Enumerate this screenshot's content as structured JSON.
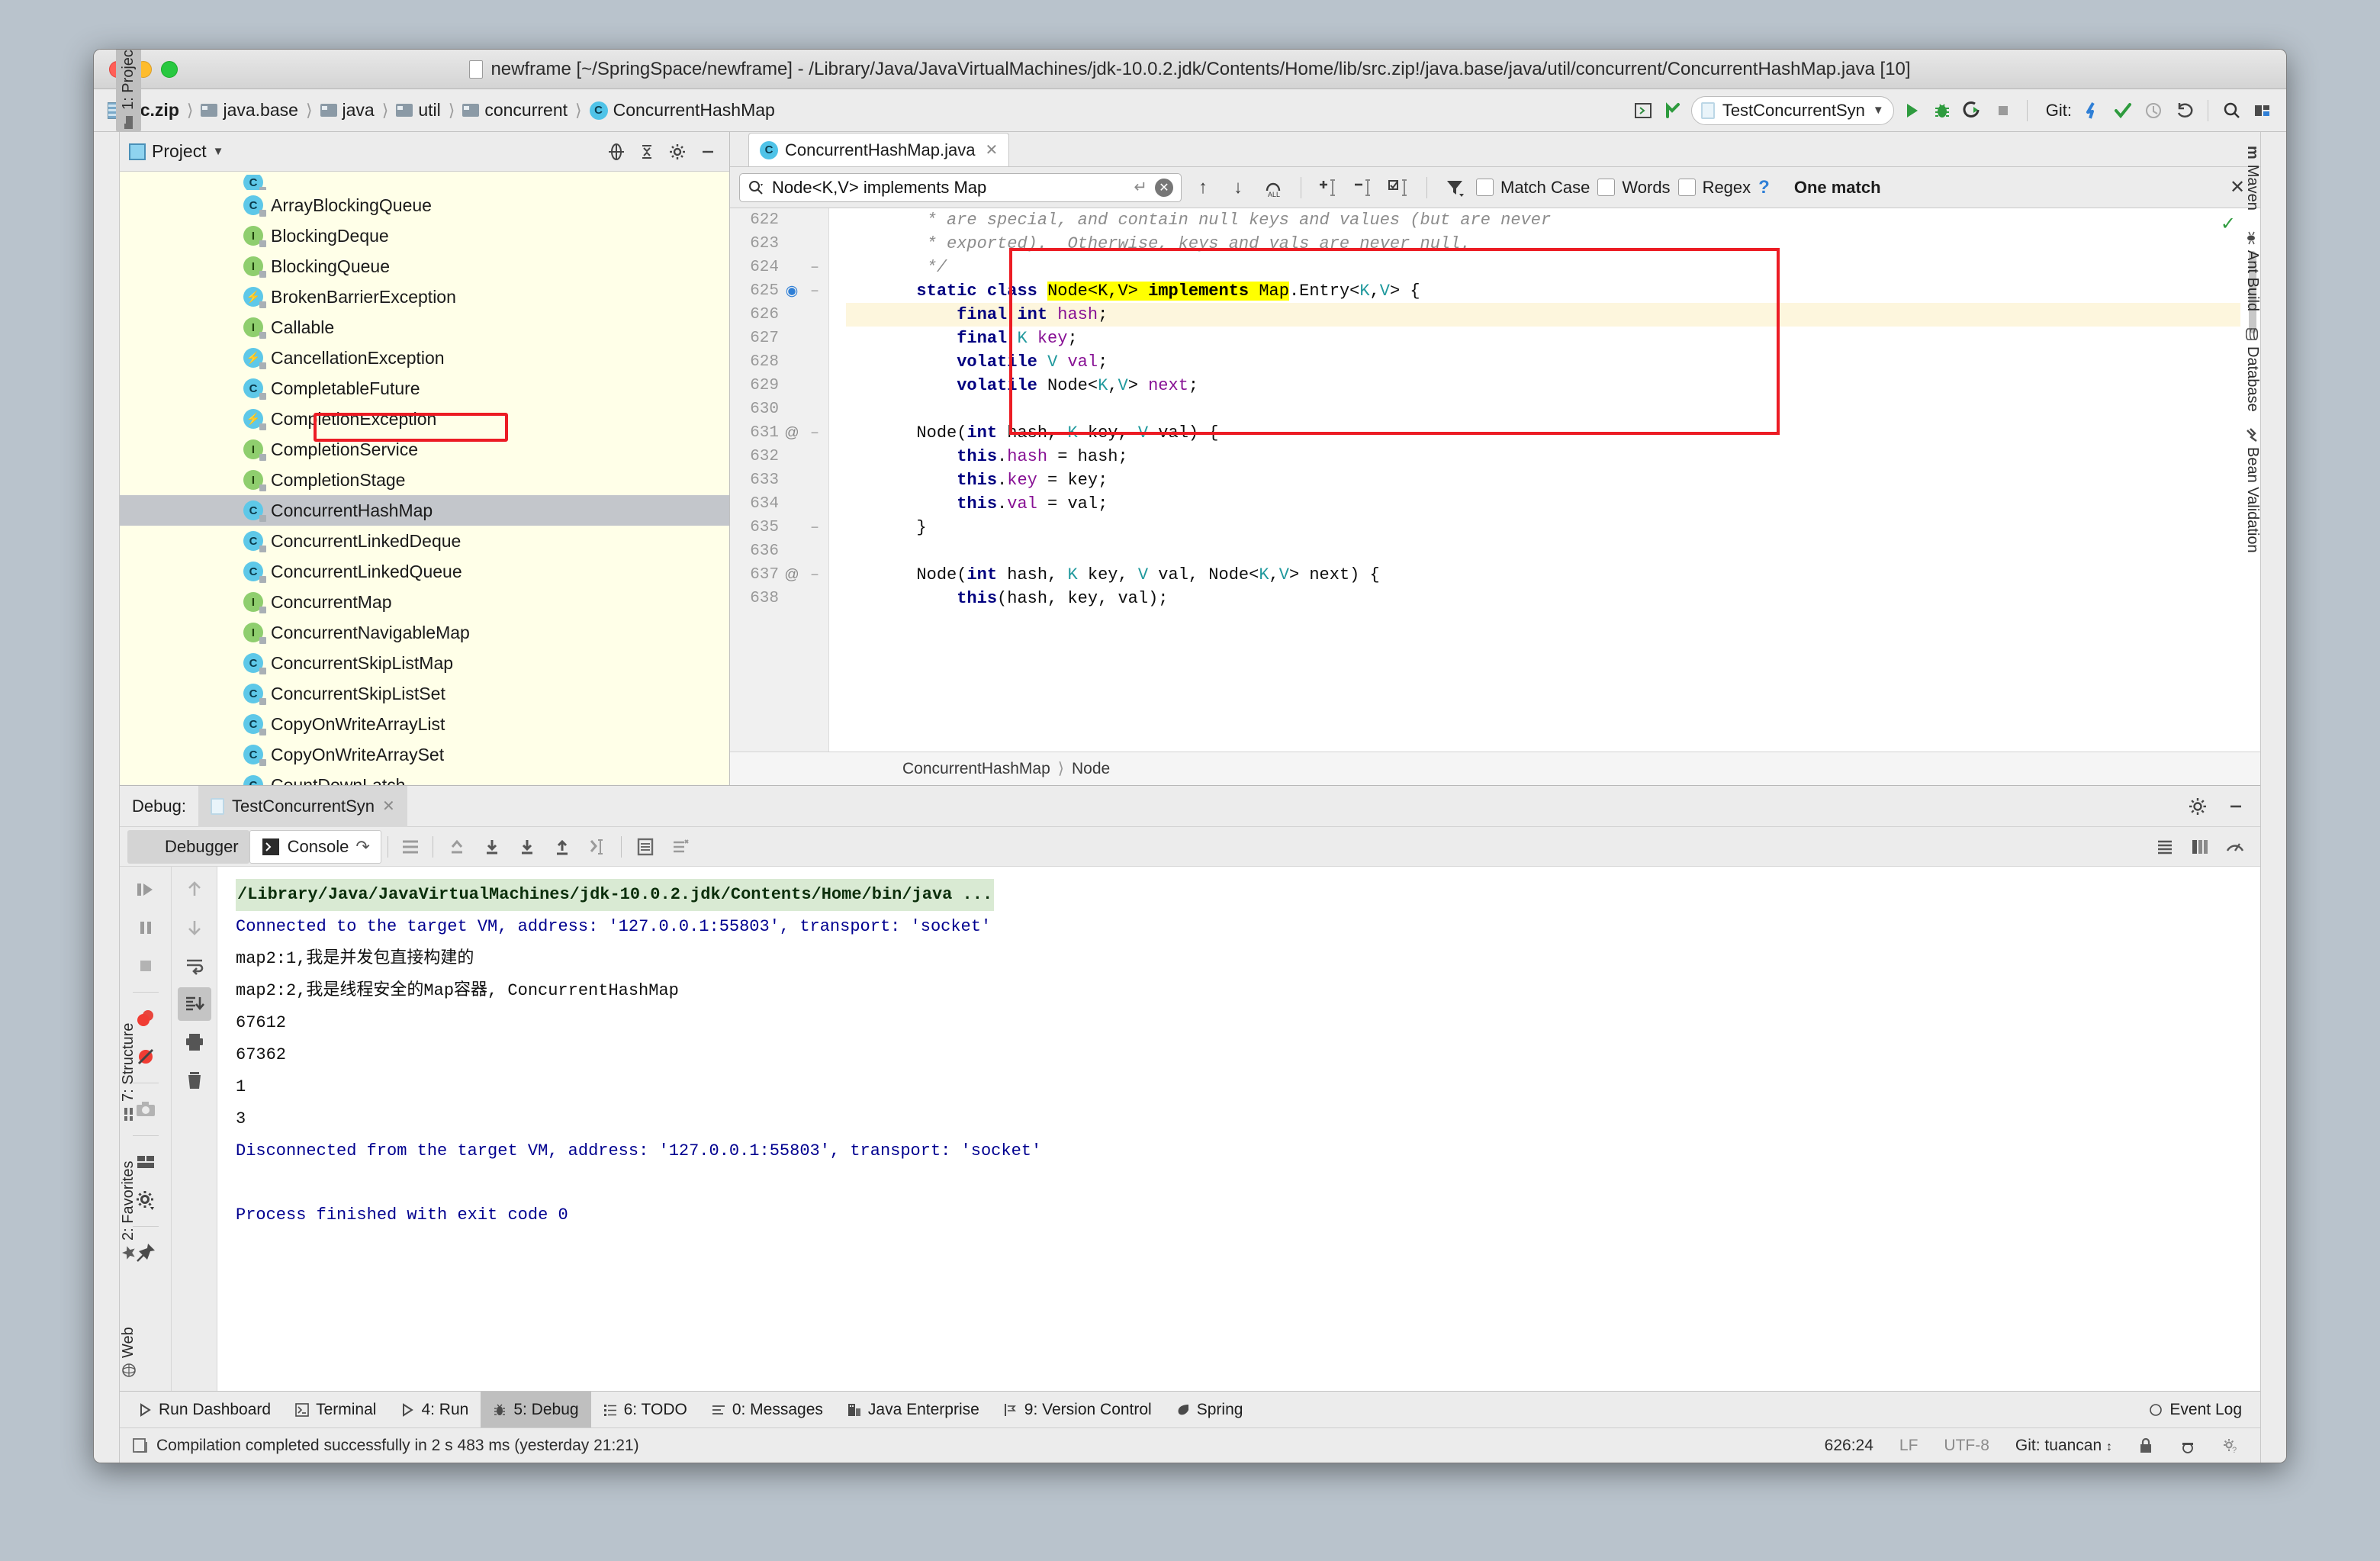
{
  "window": {
    "title": "newframe [~/SpringSpace/newframe] - /Library/Java/JavaVirtualMachines/jdk-10.0.2.jdk/Contents/Home/lib/src.zip!/java.base/java/util/concurrent/ConcurrentHashMap.java [10]"
  },
  "toolbar": {
    "breadcrumbs": [
      {
        "label": "src.zip",
        "icon": "zip-icon"
      },
      {
        "label": "java.base",
        "icon": "folder-icon"
      },
      {
        "label": "java",
        "icon": "folder-icon"
      },
      {
        "label": "util",
        "icon": "folder-icon"
      },
      {
        "label": "concurrent",
        "icon": "folder-icon"
      },
      {
        "label": "ConcurrentHashMap",
        "icon": "class-icon"
      }
    ],
    "run_config": "TestConcurrentSyn",
    "git_label": "Git:"
  },
  "left_strip": [
    {
      "label": "1: Project",
      "selected": true
    },
    {
      "label": "7: Structure",
      "selected": false
    },
    {
      "label": "2: Favorites",
      "selected": false
    },
    {
      "label": "Web",
      "selected": false
    }
  ],
  "right_strip": [
    {
      "label": "Maven"
    },
    {
      "label": "Ant Build"
    },
    {
      "label": "Database"
    },
    {
      "label": "Bean Validation"
    }
  ],
  "project_panel": {
    "title": "Project",
    "tree": [
      {
        "label": "ArrayBlockingQueue",
        "kind": "class",
        "selected": false
      },
      {
        "label": "BlockingDeque",
        "kind": "interface",
        "selected": false
      },
      {
        "label": "BlockingQueue",
        "kind": "interface",
        "selected": false
      },
      {
        "label": "BrokenBarrierException",
        "kind": "exception",
        "selected": false
      },
      {
        "label": "Callable",
        "kind": "interface",
        "selected": false
      },
      {
        "label": "CancellationException",
        "kind": "exception",
        "selected": false
      },
      {
        "label": "CompletableFuture",
        "kind": "class",
        "selected": false
      },
      {
        "label": "CompletionException",
        "kind": "exception",
        "selected": false
      },
      {
        "label": "CompletionService",
        "kind": "interface",
        "selected": false
      },
      {
        "label": "CompletionStage",
        "kind": "interface",
        "selected": false
      },
      {
        "label": "ConcurrentHashMap",
        "kind": "class",
        "selected": true
      },
      {
        "label": "ConcurrentLinkedDeque",
        "kind": "class",
        "selected": false
      },
      {
        "label": "ConcurrentLinkedQueue",
        "kind": "class",
        "selected": false
      },
      {
        "label": "ConcurrentMap",
        "kind": "interface",
        "selected": false
      },
      {
        "label": "ConcurrentNavigableMap",
        "kind": "interface",
        "selected": false
      },
      {
        "label": "ConcurrentSkipListMap",
        "kind": "class",
        "selected": false
      },
      {
        "label": "ConcurrentSkipListSet",
        "kind": "class",
        "selected": false
      },
      {
        "label": "CopyOnWriteArrayList",
        "kind": "class",
        "selected": false
      },
      {
        "label": "CopyOnWriteArraySet",
        "kind": "class",
        "selected": false
      },
      {
        "label": "CountDownLatch",
        "kind": "class",
        "selected": false
      }
    ]
  },
  "editor": {
    "tab_label": "ConcurrentHashMap.java",
    "find": {
      "query": "Node<K,V> implements Map",
      "placeholder": "Search",
      "match_case_label": "Match Case",
      "words_label": "Words",
      "regex_label": "Regex",
      "help_label": "?",
      "result_label": "One match"
    },
    "breadcrumb_bottom": [
      "ConcurrentHashMap",
      "Node"
    ],
    "lines": [
      {
        "n": 622,
        "mark": "",
        "fold": "",
        "hl": false,
        "partial": true,
        "html": "        <span class=\"cmt\">* are special, and contain null keys and values (but are never</span>"
      },
      {
        "n": 623,
        "mark": "",
        "fold": "",
        "hl": false,
        "html": "        <span class=\"cmt\">* exported).  Otherwise, keys and vals are never null.</span>"
      },
      {
        "n": 624,
        "mark": "",
        "fold": "−",
        "hl": false,
        "html": "        <span class=\"cmt\">*/</span>"
      },
      {
        "n": 625,
        "mark": "◉",
        "fold": "−",
        "hl": false,
        "html": "       <span class=\"kw\">static class</span> <span class=\"mark\">Node&lt;K,V&gt; <b>implements</b> Map</span>.Entry&lt;<span class=\"gen\">K</span>,<span class=\"gen\">V</span>&gt; {"
      },
      {
        "n": 626,
        "mark": "",
        "fold": "",
        "hl": true,
        "html": "           <span class=\"kw\">final int</span> <span class=\"fld\">hash</span>;"
      },
      {
        "n": 627,
        "mark": "",
        "fold": "",
        "hl": false,
        "html": "           <span class=\"kw\">final</span> <span class=\"gen\">K</span> <span class=\"fld\">key</span>;"
      },
      {
        "n": 628,
        "mark": "",
        "fold": "",
        "hl": false,
        "html": "           <span class=\"kw\">volatile</span> <span class=\"gen\">V</span> <span class=\"fld\">val</span>;"
      },
      {
        "n": 629,
        "mark": "",
        "fold": "",
        "hl": false,
        "html": "           <span class=\"kw\">volatile</span> Node&lt;<span class=\"gen\">K</span>,<span class=\"gen\">V</span>&gt; <span class=\"fld\">next</span>;"
      },
      {
        "n": 630,
        "mark": "",
        "fold": "",
        "hl": false,
        "html": ""
      },
      {
        "n": 631,
        "mark": "@",
        "fold": "−",
        "hl": false,
        "html": "       Node(<span class=\"kw\">int</span> hash, <span class=\"gen\">K</span> key, <span class=\"gen\">V</span> val) {"
      },
      {
        "n": 632,
        "mark": "",
        "fold": "",
        "hl": false,
        "html": "           <span class=\"kw\">this</span>.<span class=\"fld\">hash</span> = hash;"
      },
      {
        "n": 633,
        "mark": "",
        "fold": "",
        "hl": false,
        "html": "           <span class=\"kw\">this</span>.<span class=\"fld\">key</span> = key;"
      },
      {
        "n": 634,
        "mark": "",
        "fold": "",
        "hl": false,
        "html": "           <span class=\"kw\">this</span>.<span class=\"fld\">val</span> = val;"
      },
      {
        "n": 635,
        "mark": "",
        "fold": "−",
        "hl": false,
        "html": "       }"
      },
      {
        "n": 636,
        "mark": "",
        "fold": "",
        "hl": false,
        "html": ""
      },
      {
        "n": 637,
        "mark": "@",
        "fold": "−",
        "hl": false,
        "html": "       Node(<span class=\"kw\">int</span> hash, <span class=\"gen\">K</span> key, <span class=\"gen\">V</span> val, Node&lt;<span class=\"gen\">K</span>,<span class=\"gen\">V</span>&gt; next) {"
      },
      {
        "n": 638,
        "mark": "",
        "fold": "",
        "hl": false,
        "html": "           <span class=\"kw\">this</span>(hash, key, val);"
      }
    ]
  },
  "debug": {
    "header_label": "Debug:",
    "session_tab": "TestConcurrentSyn",
    "tabs": [
      {
        "label": "Debugger",
        "selected": false
      },
      {
        "label": "Console",
        "selected": true
      }
    ],
    "console_lines": [
      {
        "text": "/Library/Java/JavaVirtualMachines/jdk-10.0.2.jdk/Contents/Home/bin/java ...",
        "style": "cmd"
      },
      {
        "text": "Connected to the target VM, address: '127.0.0.1:55803', transport: 'socket'",
        "style": "vm"
      },
      {
        "text": "map2:1,我是并发包直接构建的",
        "style": "plain"
      },
      {
        "text": "map2:2,我是线程安全的Map容器, ConcurrentHashMap",
        "style": "plain"
      },
      {
        "text": "67612",
        "style": "plain"
      },
      {
        "text": "67362",
        "style": "plain"
      },
      {
        "text": "1",
        "style": "plain"
      },
      {
        "text": "3",
        "style": "plain"
      },
      {
        "text": "Disconnected from the target VM, address: '127.0.0.1:55803', transport: 'socket'",
        "style": "vm"
      },
      {
        "text": "",
        "style": "blank"
      },
      {
        "text": "Process finished with exit code 0",
        "style": "vm"
      }
    ]
  },
  "bottom_strip": [
    {
      "label": "Run Dashboard",
      "key": "",
      "icon": "play-icon",
      "selected": false
    },
    {
      "label": "Terminal",
      "key": "",
      "icon": "terminal-icon",
      "selected": false
    },
    {
      "label": "4: Run",
      "key": "4",
      "icon": "play-icon",
      "selected": false
    },
    {
      "label": "5: Debug",
      "key": "5",
      "icon": "bug-icon",
      "selected": true
    },
    {
      "label": "6: TODO",
      "key": "6",
      "icon": "list-icon",
      "selected": false
    },
    {
      "label": "0: Messages",
      "key": "0",
      "icon": "messages-icon",
      "selected": false
    },
    {
      "label": "Java Enterprise",
      "key": "",
      "icon": "enterprise-icon",
      "selected": false
    },
    {
      "label": "9: Version Control",
      "key": "9",
      "icon": "vcs-icon",
      "selected": false
    },
    {
      "label": "Spring",
      "key": "",
      "icon": "spring-leaf-icon",
      "selected": false
    }
  ],
  "event_log_label": "Event Log",
  "statusbar": {
    "message": "Compilation completed successfully in 2 s 483 ms (yesterday 21:21)",
    "caret": "626:24",
    "line_sep": "LF",
    "encoding": "UTF-8",
    "git_branch": "Git: tuancan"
  },
  "colors": {
    "accent": "#3f8ad6",
    "annotation_red": "#ec1c24",
    "highlight_yellow": "#ffff00",
    "keyword_navy": "#000080",
    "field_purple": "#871094",
    "generic_teal": "#20999d",
    "tree_bg": "#ffffe8"
  }
}
